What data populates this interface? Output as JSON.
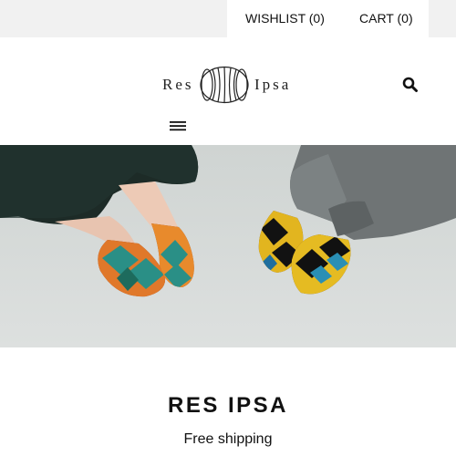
{
  "header": {
    "wishlist_label": "WISHLIST (0)",
    "cart_label": "CART (0)",
    "logo_left": "Res",
    "logo_right": "Ipsa",
    "search_icon": "search-icon",
    "menu_icon": "hamburger-menu-icon"
  },
  "hero": {
    "image_alt": "Two people standing in colorful kilim slip-on shoes"
  },
  "main": {
    "title": "RES IPSA",
    "subtitle": "Free shipping"
  },
  "colors": {
    "topbar_bg": "#f1f1f1",
    "text": "#111111",
    "floor": "#d6dad8"
  }
}
